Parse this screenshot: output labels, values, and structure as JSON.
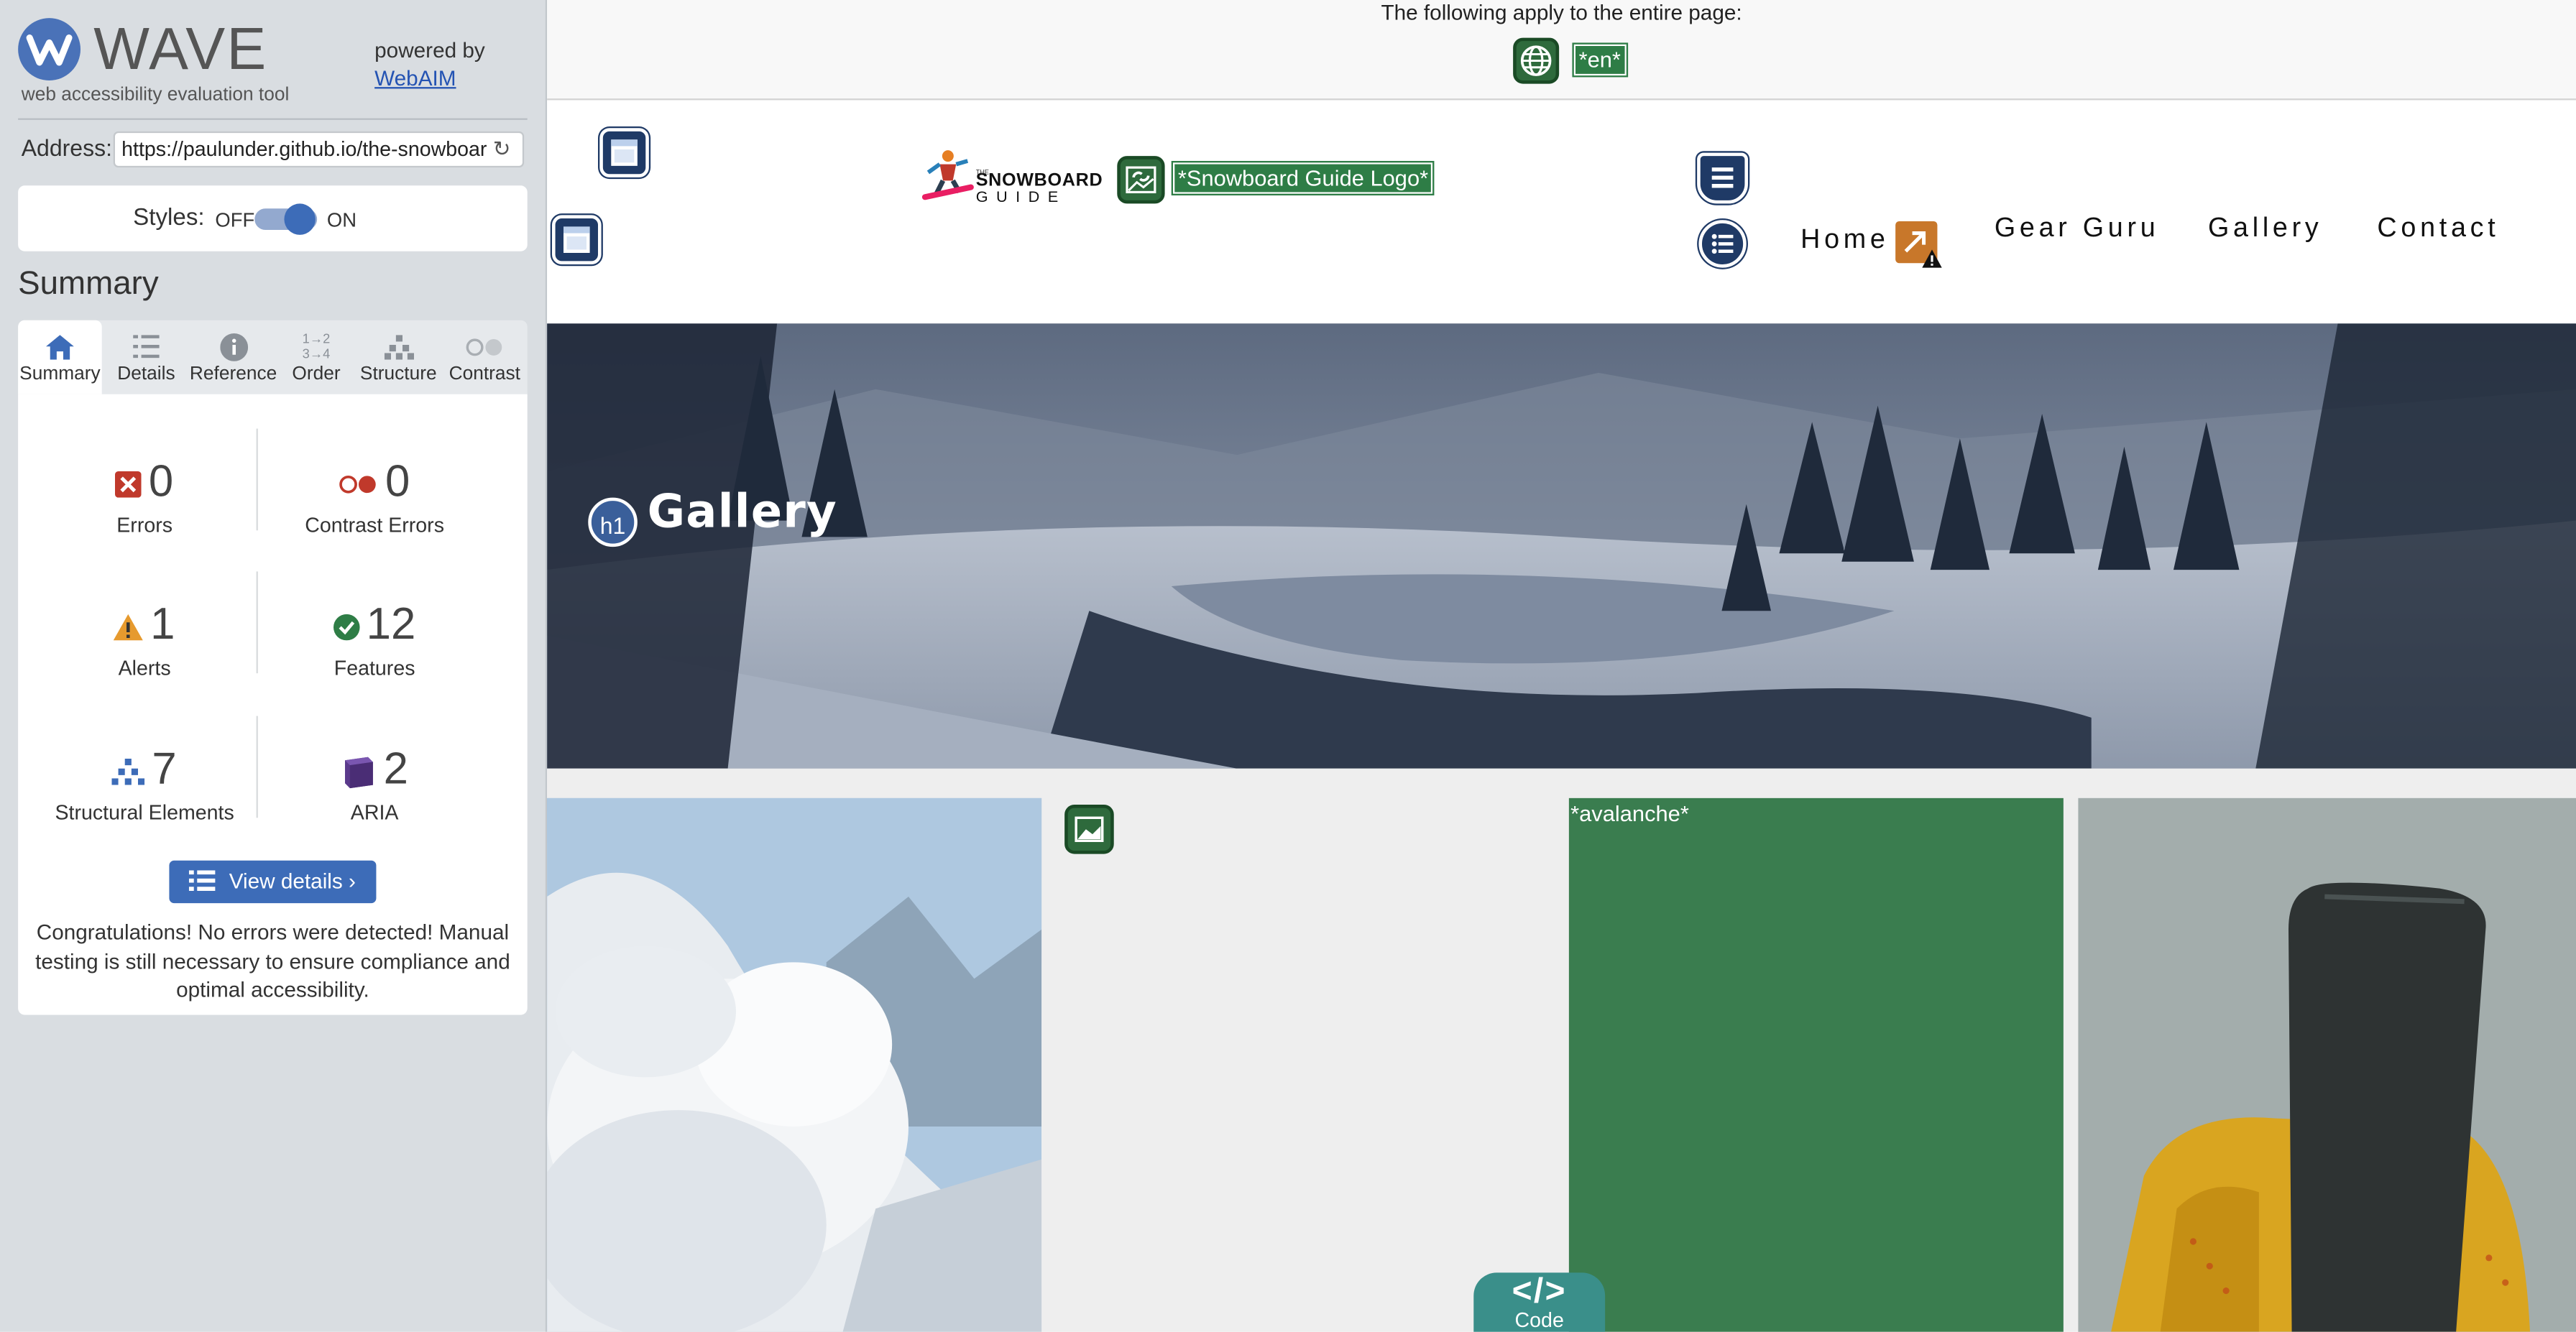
{
  "wave": {
    "title": "WAVE",
    "subtitle": "web accessibility evaluation tool",
    "powered_by": "powered by",
    "powered_link": "WebAIM",
    "address_label": "Address:",
    "address_value": "https://paulunder.github.io/the-snowboar",
    "styles_label": "Styles:",
    "styles_off": "OFF",
    "styles_on": "ON",
    "summary_heading": "Summary",
    "tabs": [
      {
        "label": "Summary",
        "icon": "home-icon",
        "active": true
      },
      {
        "label": "Details",
        "icon": "list-icon"
      },
      {
        "label": "Reference",
        "icon": "info-icon"
      },
      {
        "label": "Order",
        "icon": "order-icon"
      },
      {
        "label": "Structure",
        "icon": "structure-icon"
      },
      {
        "label": "Contrast",
        "icon": "contrast-icon"
      }
    ],
    "stats": {
      "errors": {
        "count": "0",
        "label": "Errors"
      },
      "contrast_errors": {
        "count": "0",
        "label": "Contrast Errors"
      },
      "alerts": {
        "count": "1",
        "label": "Alerts"
      },
      "features": {
        "count": "12",
        "label": "Features"
      },
      "structural": {
        "count": "7",
        "label": "Structural Elements"
      },
      "aria": {
        "count": "2",
        "label": "ARIA"
      }
    },
    "view_details": "View details ›",
    "congrats": "Congratulations! No errors were detected! Manual testing is still necessary to ensure compliance and optimal accessibility."
  },
  "page": {
    "notice": "The following apply to the entire page:",
    "lang_tag": "*en*",
    "logo_alt": "*Snowboard Guide Logo*",
    "logo_text_top": "THE",
    "logo_text_mid": "SNOWBOARD",
    "logo_text_bot": "GUIDE",
    "nav": [
      "Home",
      "Gear Guru",
      "Gallery",
      "Contact"
    ],
    "hero_heading": "Gallery",
    "h1_badge": "h1",
    "avalanche_alt": "*avalanche*",
    "code_label": "Code",
    "code_symbol": "</>"
  },
  "colors": {
    "wave_blue": "#3d6cb8",
    "feature_green": "#2e7d46",
    "structure_navy": "#1f3a66",
    "alert_orange": "#c8772a",
    "error_red": "#c0392b"
  }
}
